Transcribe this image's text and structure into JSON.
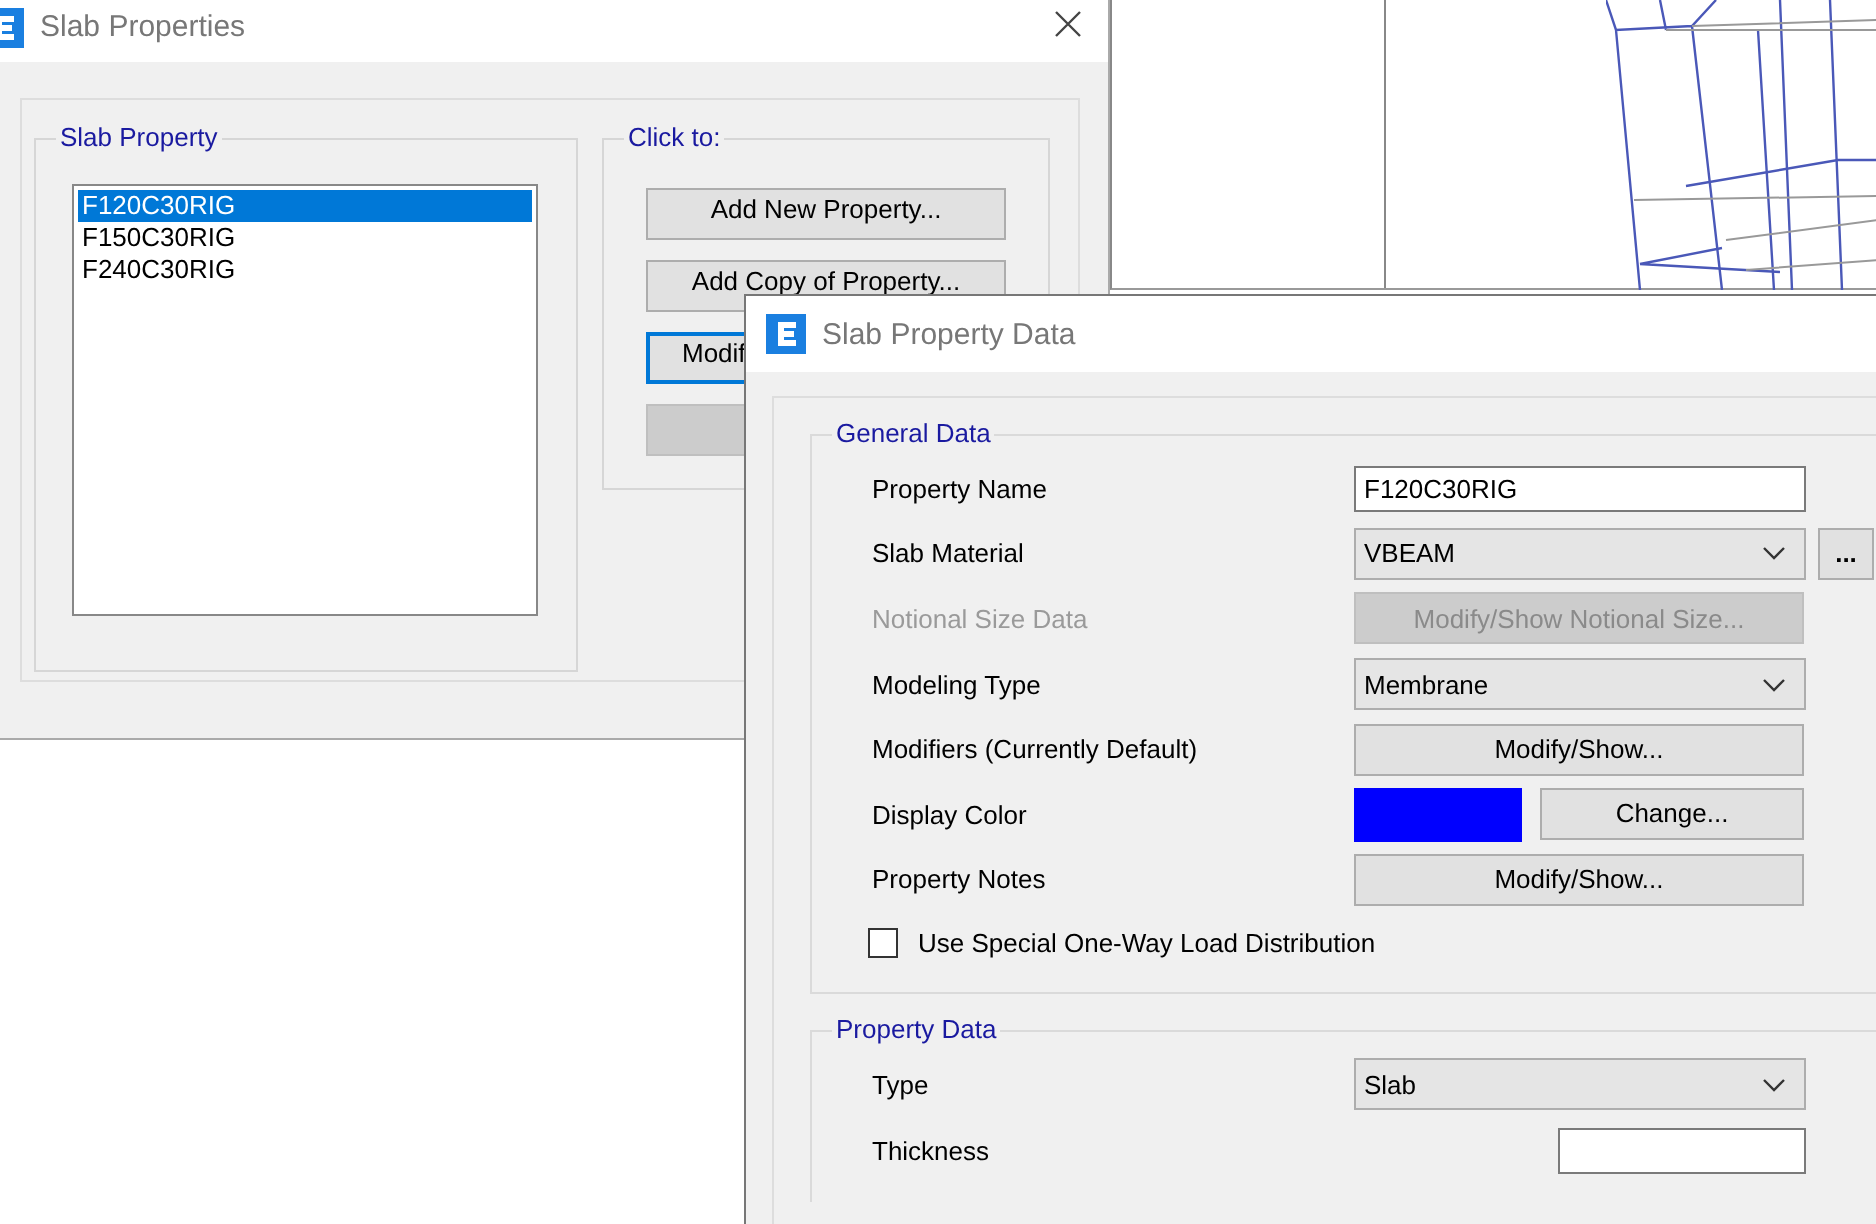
{
  "slab_properties": {
    "title": "Slab Properties",
    "list_group": "Slab Property",
    "properties": [
      {
        "name": "F120C30RIG",
        "selected": true
      },
      {
        "name": "F150C30RIG",
        "selected": false
      },
      {
        "name": "F240C30RIG",
        "selected": false
      }
    ],
    "click_group": "Click to:",
    "buttons": [
      {
        "label": "Add New Property...",
        "kind": "normal"
      },
      {
        "label": "Add Copy of Property...",
        "kind": "normal"
      },
      {
        "label": "Modif",
        "kind": "default"
      },
      {
        "kind": "disabled"
      }
    ]
  },
  "slab_property_data": {
    "title": "Slab Property Data",
    "general_data": {
      "title": "General Data",
      "rows": [
        {
          "label": "Property Name",
          "kind": "text",
          "value": "F120C30RIG",
          "disabled": false
        },
        {
          "label": "Slab Material",
          "kind": "dropdown",
          "value": "VBEAM",
          "extra_button": "...",
          "disabled": false
        },
        {
          "label": "Notional Size Data",
          "kind": "button",
          "button": "Modify/Show Notional Size...",
          "disabled": true
        },
        {
          "label": "Modeling Type",
          "kind": "dropdown",
          "value": "Membrane",
          "disabled": false
        },
        {
          "label": "Modifiers (Currently Default)",
          "kind": "button",
          "button": "Modify/Show...",
          "disabled": false
        },
        {
          "label": "Display Color",
          "kind": "color",
          "color": "#0000ff",
          "button": "Change...",
          "disabled": false
        },
        {
          "label": "Property Notes",
          "kind": "button",
          "button": "Modify/Show...",
          "disabled": false
        }
      ],
      "checkbox": {
        "label": "Use Special One-Way Load Distribution",
        "checked": false
      }
    },
    "property_data": {
      "title": "Property Data",
      "rows": [
        {
          "label": "Type",
          "kind": "dropdown",
          "value": "Slab",
          "disabled": false
        },
        {
          "label": "Thickness",
          "kind": "text",
          "disabled": false
        }
      ]
    }
  }
}
